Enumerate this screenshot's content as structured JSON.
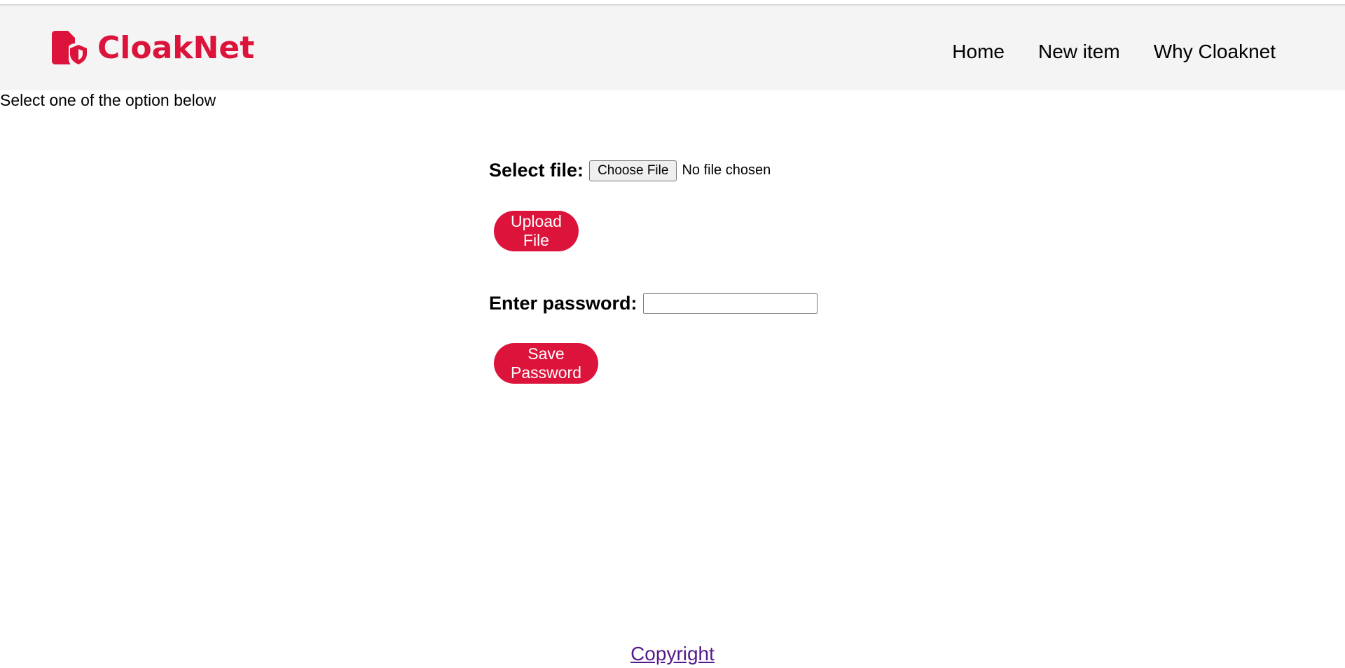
{
  "brand": {
    "name": "CloakNet",
    "logo_icon": "file-shield-icon",
    "color": "#dc143c"
  },
  "nav": {
    "items": [
      {
        "label": "Home"
      },
      {
        "label": "New item"
      },
      {
        "label": "Why Cloaknet"
      }
    ]
  },
  "page": {
    "instruction": "Select one of the option below"
  },
  "upload": {
    "label": "Select file:",
    "choose_button": "Choose File",
    "file_status": "No file chosen",
    "submit_label": "Upload File"
  },
  "password": {
    "label": "Enter password:",
    "value": "",
    "submit_label": "Save Password"
  },
  "footer": {
    "link": "Copyright"
  },
  "colors": {
    "accent": "#dc143c",
    "header_bg": "#f4f4f4",
    "visited_link": "#551a8b"
  }
}
